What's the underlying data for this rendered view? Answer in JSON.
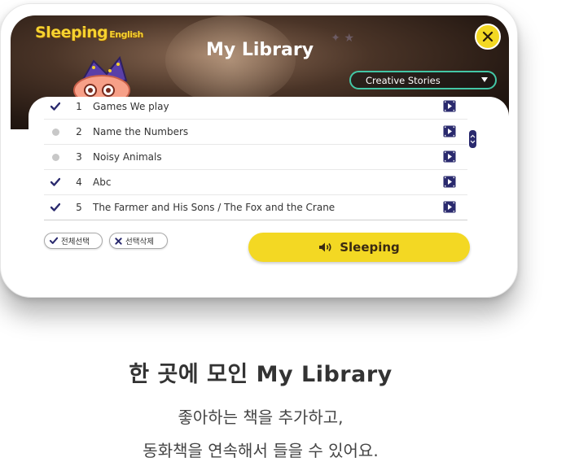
{
  "app": {
    "logo_main": "Sleeping",
    "logo_sub": "English",
    "title": "My Library",
    "close_label": "×"
  },
  "category_dropdown": {
    "selected": "Creative Stories"
  },
  "books": [
    {
      "number": "1",
      "title": "Games We play",
      "selected": true
    },
    {
      "number": "2",
      "title": "Name the Numbers",
      "selected": false
    },
    {
      "number": "3",
      "title": "Noisy Animals",
      "selected": false
    },
    {
      "number": "4",
      "title": "Abc",
      "selected": true
    },
    {
      "number": "5",
      "title": "The Farmer and His Sons / The Fox and the Crane",
      "selected": true
    }
  ],
  "actions": {
    "select_all_label": "전체선택",
    "delete_selected_label": "선택삭제",
    "sleeping_label": "Sleeping"
  },
  "caption": {
    "title": "한 곳에 모인 My Library",
    "line1": "좋아하는 책을 추가하고,",
    "line2": "동화책을 연속해서 들을 수 있어요."
  },
  "colors": {
    "accent_yellow": "#f3d823",
    "logo_yellow": "#f6d22f",
    "dropdown_border": "#43c7a6",
    "check_navy": "#2a2a6e",
    "unselected_dot": "#c8c8c8"
  },
  "icons": {
    "close": "close-icon",
    "dropdown": "caret-down-icon",
    "check": "check-icon",
    "play": "video-play-icon",
    "speaker": "speaker-icon",
    "delete": "x-icon",
    "scroll": "scroll-handle-icon"
  }
}
